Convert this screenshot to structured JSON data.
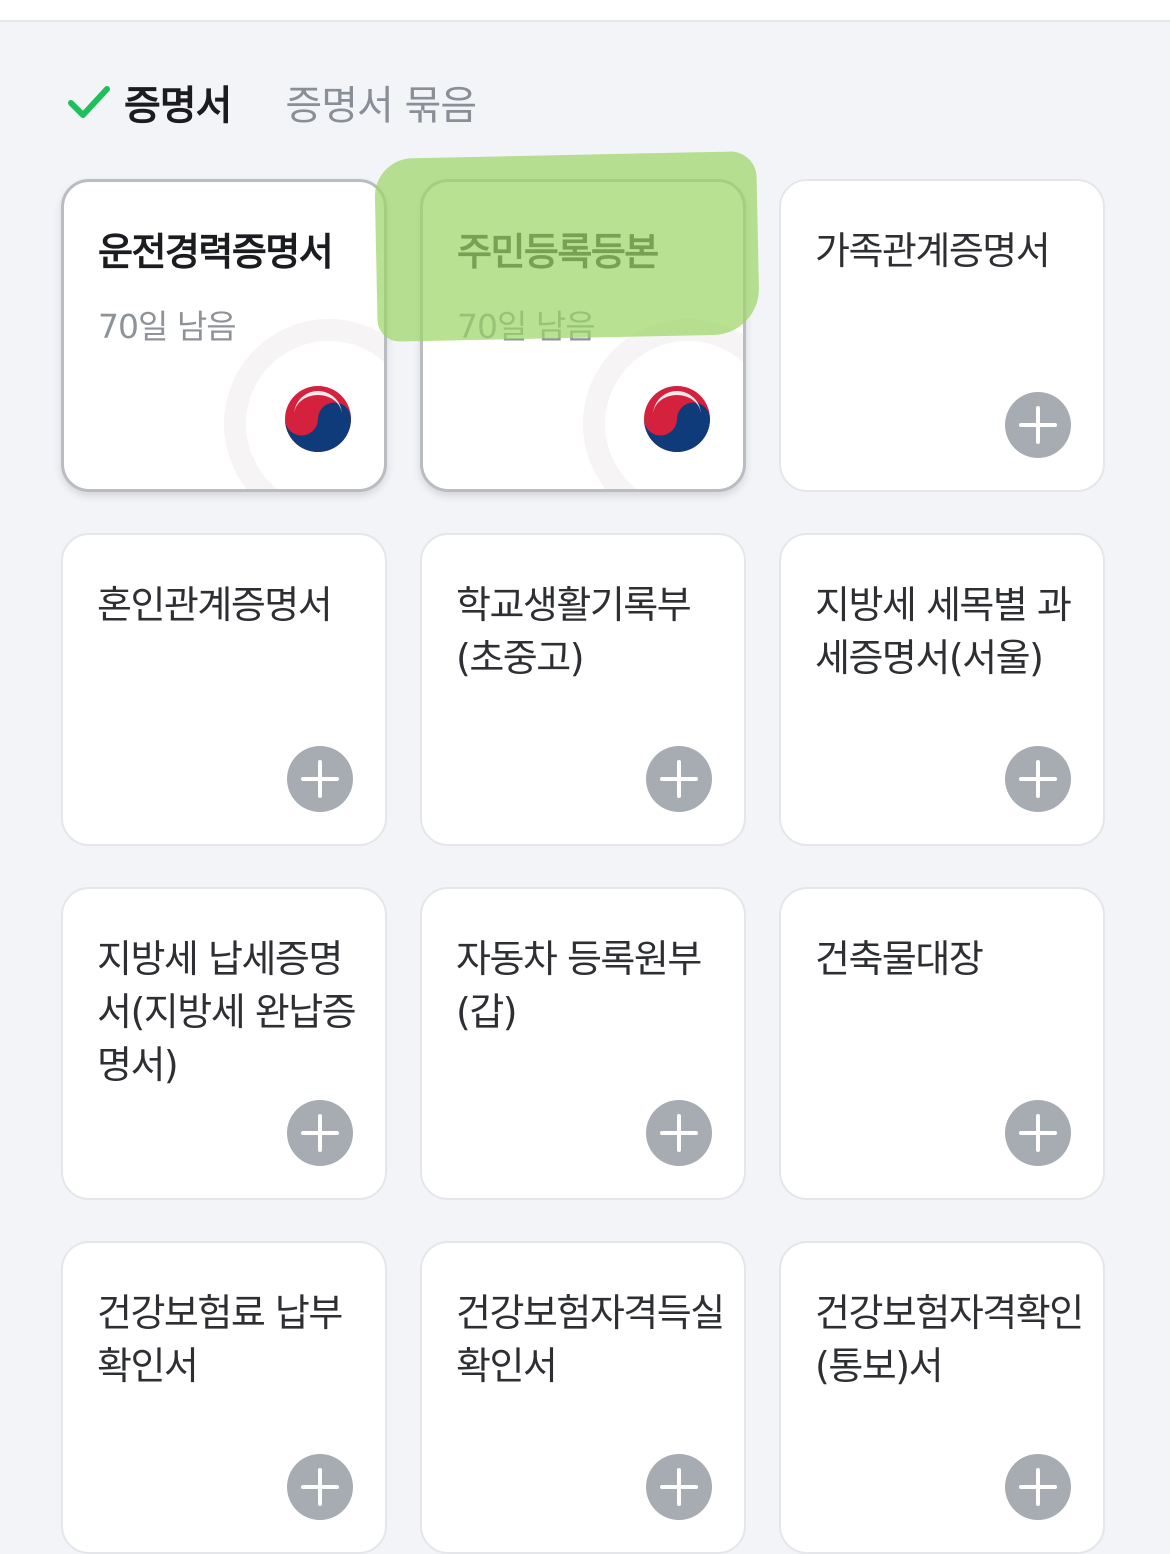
{
  "tabs": {
    "active_label": "증명서",
    "other_label": "증명서 묶음"
  },
  "cards": [
    {
      "title": "운전경력증명서",
      "subtitle": "70일 남음",
      "issued": true,
      "action": "gov-emblem"
    },
    {
      "title": "주민등록등본",
      "subtitle": "70일 남음",
      "issued": true,
      "action": "gov-emblem"
    },
    {
      "title": "가족관계증명서",
      "issued": false,
      "action": "add"
    },
    {
      "title": "혼인관계증명서",
      "issued": false,
      "action": "add"
    },
    {
      "title": "학교생활기록부(초중고)",
      "issued": false,
      "action": "add"
    },
    {
      "title": "지방세 세목별 과세증명서(서울)",
      "issued": false,
      "action": "add"
    },
    {
      "title": "지방세 납세증명서(지방세 완납증명서)",
      "issued": false,
      "action": "add"
    },
    {
      "title": "자동차 등록원부(갑)",
      "issued": false,
      "action": "add"
    },
    {
      "title": "건축물대장",
      "issued": false,
      "action": "add"
    },
    {
      "title": "건강보험료 납부확인서",
      "issued": false,
      "action": "add"
    },
    {
      "title": "건강보험자격득실확인서",
      "issued": false,
      "action": "add"
    },
    {
      "title": "건강보험자격확인(통보)서",
      "issued": false,
      "action": "add"
    }
  ],
  "colors": {
    "check": "#1fbf5c",
    "highlight": "#9cd668",
    "emblem_red": "#d4213d",
    "emblem_blue": "#0f3b7a"
  }
}
